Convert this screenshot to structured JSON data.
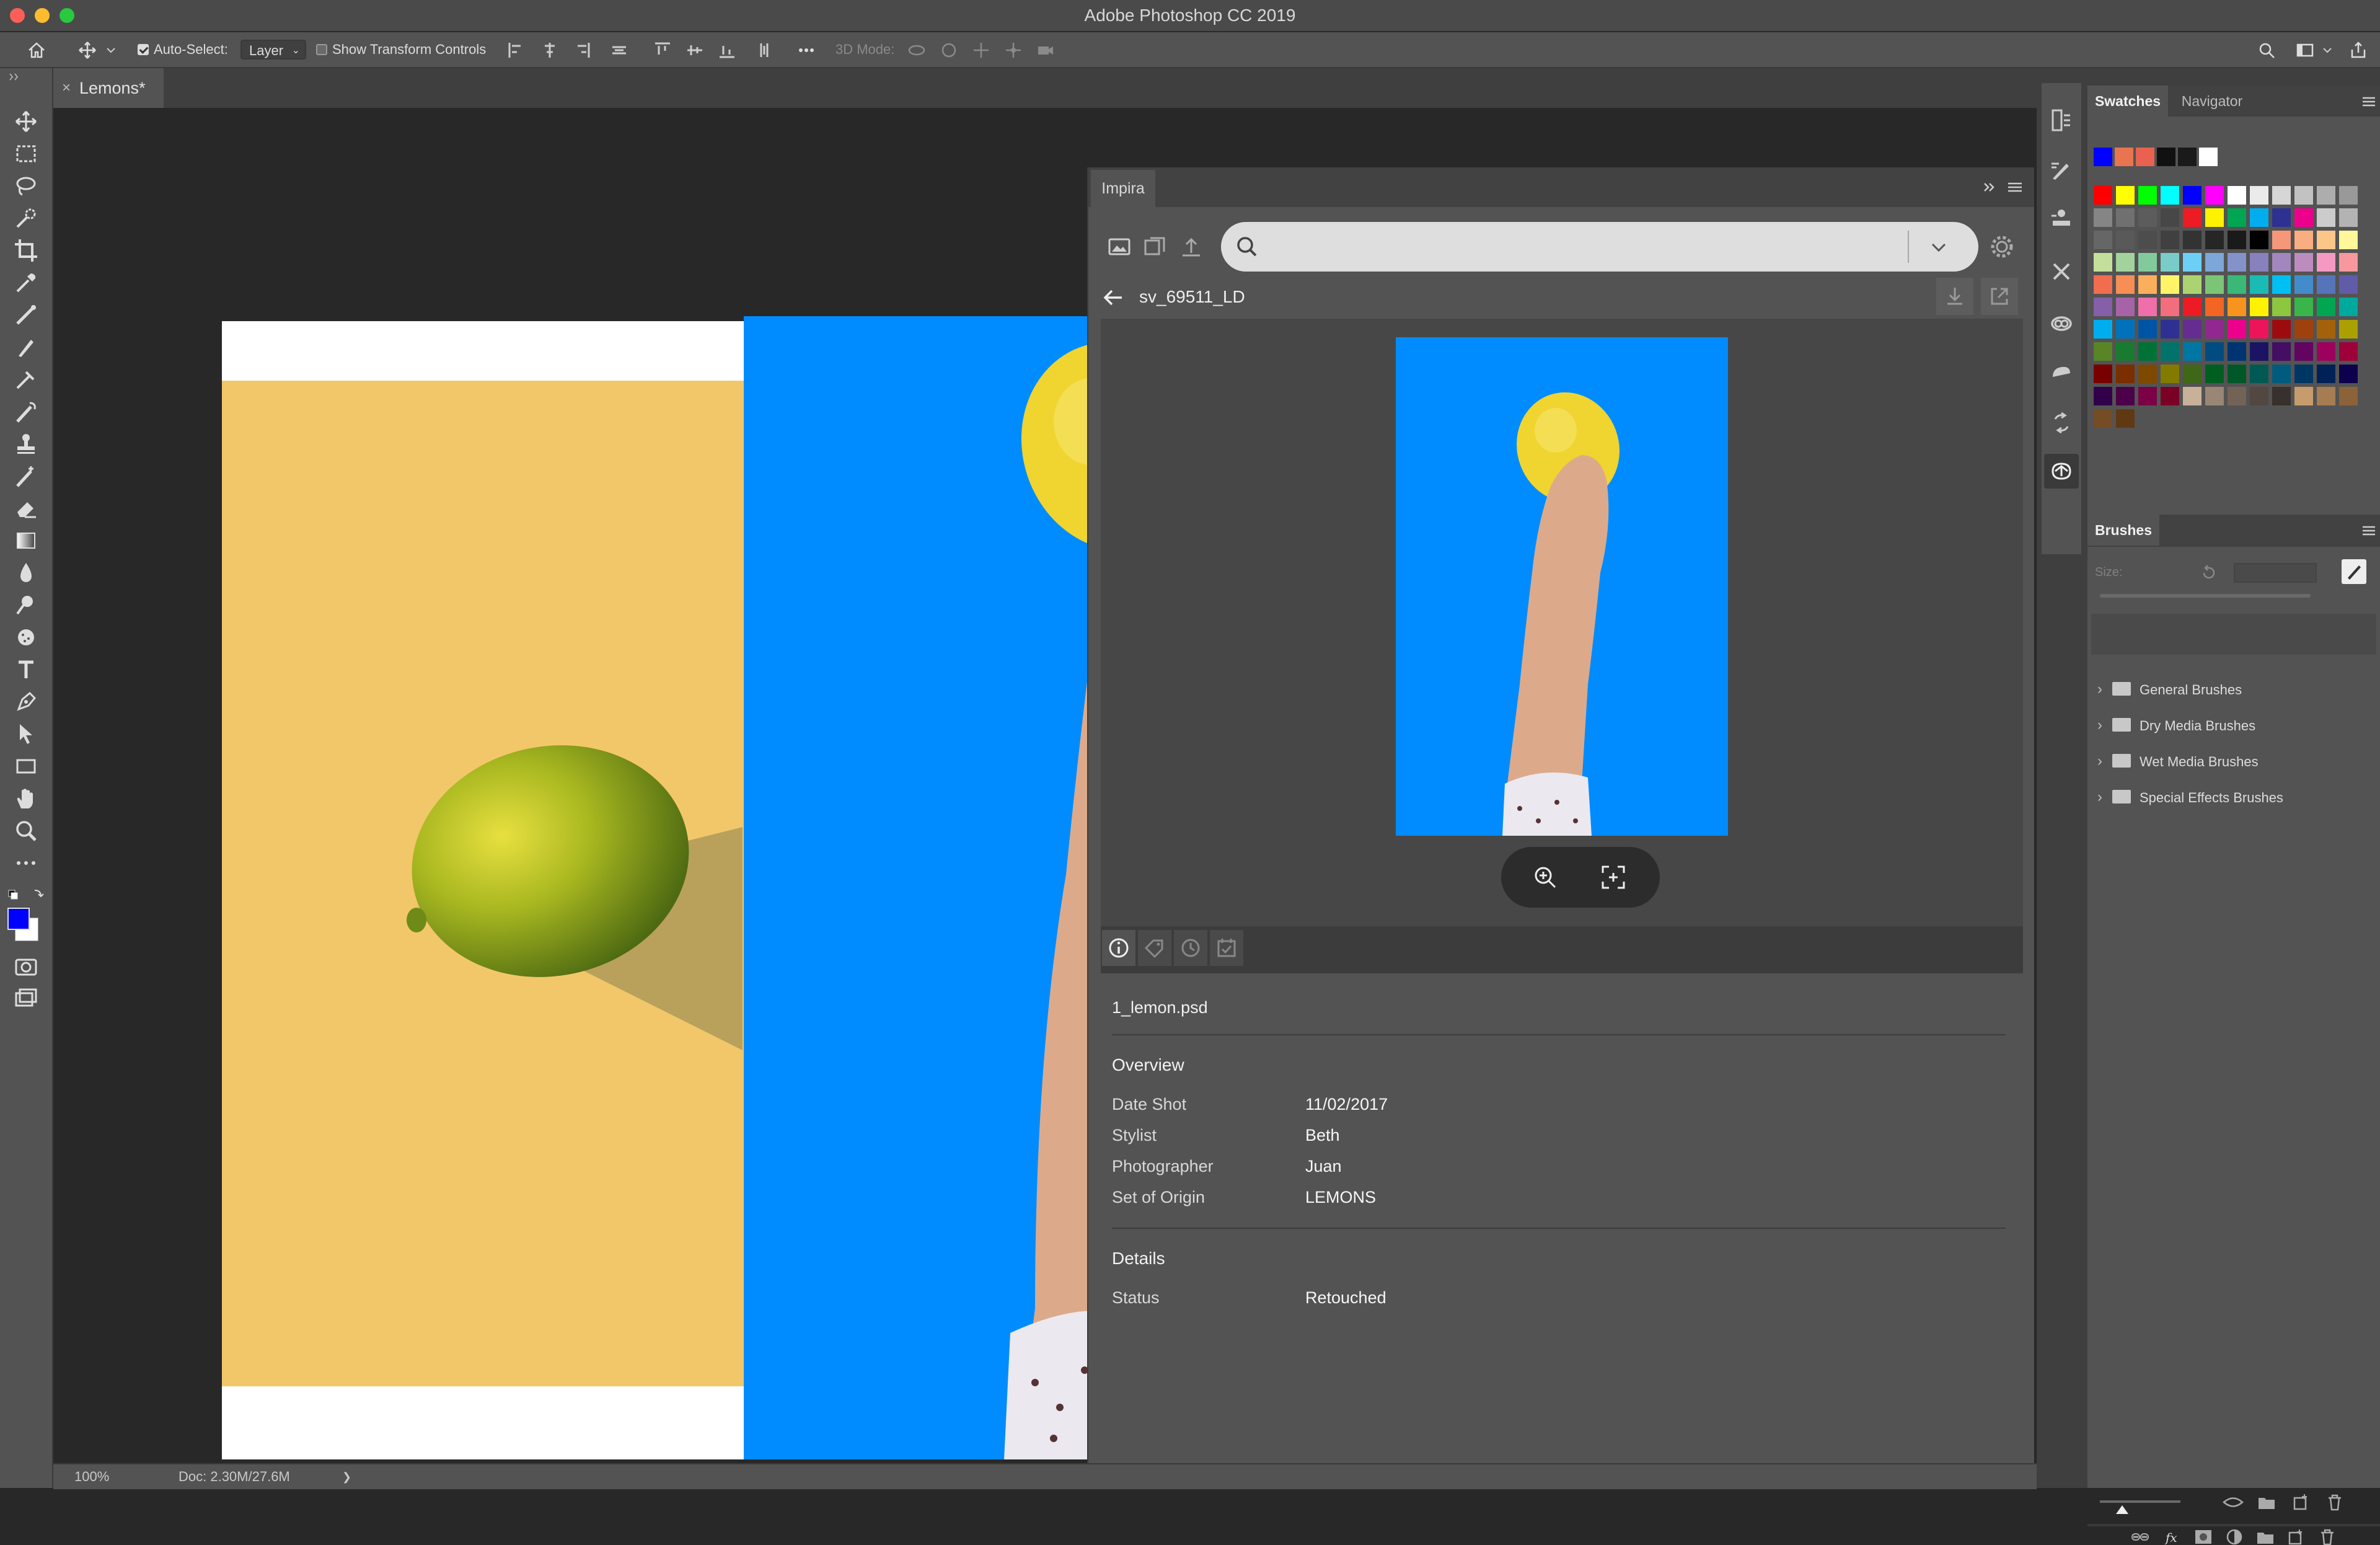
{
  "window": {
    "title": "Adobe Photoshop CC 2019",
    "traffic_colors": [
      "#fc5f57",
      "#fdbc2e",
      "#28c840"
    ]
  },
  "options_bar": {
    "auto_select_label": "Auto-Select:",
    "auto_select_checked": true,
    "auto_select_value": "Layer",
    "show_transform_label": "Show Transform Controls",
    "show_transform_checked": false,
    "mode_label": "3D Mode:"
  },
  "document": {
    "tab_label": "Lemons*",
    "close_glyph": "×"
  },
  "status_bar": {
    "zoom": "100%",
    "doc_info": "Doc: 2.30M/27.6M",
    "arrow": "❯"
  },
  "impira": {
    "tab_label": "Impira",
    "search_placeholder": "",
    "asset_title": "sv_69511_LD",
    "file_name": "1_lemon.psd",
    "overview": {
      "heading": "Overview",
      "fields": [
        {
          "label": "Date Shot",
          "value": "11/02/2017"
        },
        {
          "label": "Stylist",
          "value": "Beth"
        },
        {
          "label": "Photographer",
          "value": "Juan"
        },
        {
          "label": "Set of Origin",
          "value": "LEMONS"
        }
      ]
    },
    "details": {
      "heading": "Details",
      "fields": [
        {
          "label": "Status",
          "value": "Retouched"
        }
      ]
    }
  },
  "swatches_panel": {
    "tabs": [
      "Swatches",
      "Navigator"
    ],
    "recent": [
      "#0000ff",
      "#e8754f",
      "#e8624f",
      "#111111",
      "#1a1a1a",
      "#ffffff"
    ],
    "grid": [
      [
        "#ff0000",
        "#ffff00",
        "#00ff00",
        "#00ffff",
        "#0000ff",
        "#ff00ff",
        "#ffffff",
        "#ebebeb",
        "#d6d6d6",
        "#c2c2c2",
        "#adadad",
        "#999999"
      ],
      [
        "#858585",
        "#707070",
        "#5c5c5c",
        "#474747",
        "#ed1c24",
        "#fff200",
        "#00a651",
        "#00aeef",
        "#2e3192",
        "#ec008c",
        "#cccccc",
        "#b3b3b3"
      ],
      [
        "#666666",
        "#595959",
        "#4d4d4d",
        "#404040",
        "#333333",
        "#262626",
        "#1a1a1a",
        "#000000",
        "#f7977a",
        "#fbad82",
        "#fdc689",
        "#fff799"
      ],
      [
        "#c4df9b",
        "#a3d39c",
        "#82ca9c",
        "#7accc8",
        "#6dcff6",
        "#7da7d9",
        "#8393ca",
        "#8781bd",
        "#a187be",
        "#bc8cbf",
        "#f49ac1",
        "#f6989d"
      ],
      [
        "#f26c4f",
        "#f68e55",
        "#fbaf5c",
        "#fff467",
        "#acd372",
        "#7cc576",
        "#3bb878",
        "#1abbb4",
        "#00bff3",
        "#438ccb",
        "#5574b9",
        "#605ca8"
      ],
      [
        "#855fa8",
        "#a763a8",
        "#f06eaa",
        "#f26d7d",
        "#ed1c24",
        "#f26522",
        "#f7941d",
        "#fff200",
        "#8dc63f",
        "#39b54a",
        "#00a651",
        "#00a99d"
      ],
      [
        "#00aeef",
        "#0072bc",
        "#0054a6",
        "#2e3192",
        "#662d91",
        "#92278f",
        "#ec008c",
        "#ed145b",
        "#9e0b0f",
        "#a0410d",
        "#a36209",
        "#aba000"
      ],
      [
        "#598527",
        "#197b30",
        "#007236",
        "#00746b",
        "#0076a3",
        "#004b80",
        "#003471",
        "#1b1464",
        "#440e62",
        "#630460",
        "#9e005d",
        "#9e0039"
      ],
      [
        "#790000",
        "#7b2e00",
        "#7d4900",
        "#827b00",
        "#406618",
        "#005e20",
        "#005826",
        "#005952",
        "#005b7f",
        "#003663",
        "#002157",
        "#0d004c"
      ],
      [
        "#32004b",
        "#4b0049",
        "#7b0046",
        "#7a0026",
        "#c7b299",
        "#998675",
        "#736357",
        "#534741",
        "#37302c",
        "#c69c6d",
        "#a67c52",
        "#8c6239"
      ],
      [
        "#754c24",
        "#603913"
      ]
    ]
  },
  "brushes_panel": {
    "tab_label": "Brushes",
    "size_label": "Size:",
    "groups": [
      "General Brushes",
      "Dry Media Brushes",
      "Wet Media Brushes",
      "Special Effects Brushes"
    ]
  }
}
